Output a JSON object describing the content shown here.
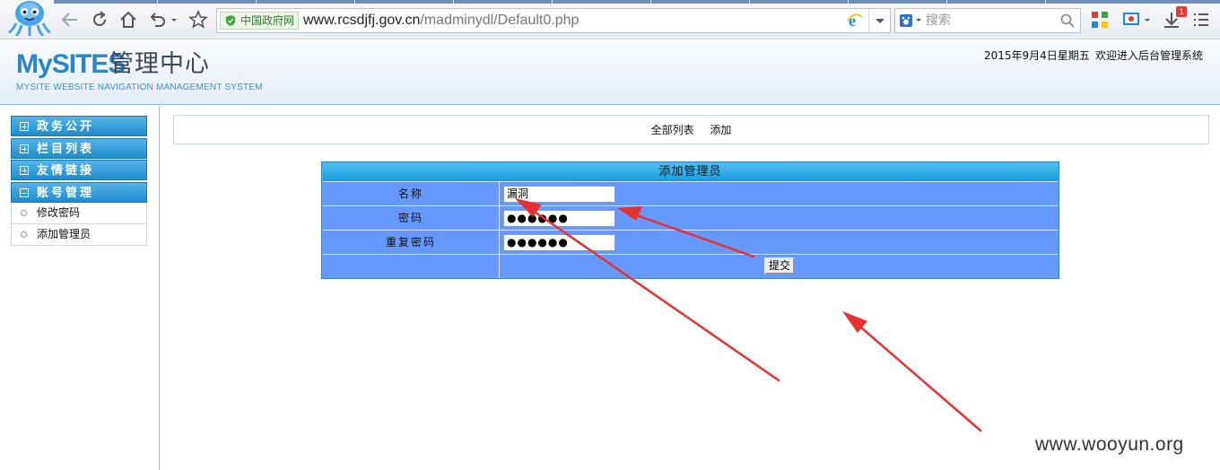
{
  "browser": {
    "url_host": "www.rcsdjfj.gov.cn",
    "url_path": "/madminydl/Default0.php",
    "gov_badge": "中国政府网",
    "search_placeholder": "搜索",
    "download_badge": "1"
  },
  "header": {
    "brand_part1": "My",
    "brand_part2": "SITES",
    "brand_cn": "管理中心",
    "brand_sub": "MYSITE WEBSITE NAVIGATION MANAGEMENT SYSTEM",
    "date": "2015年9月4日星期五",
    "welcome": "欢迎进入后台管理系统"
  },
  "sidebar": {
    "menus": [
      {
        "label": "政务公开",
        "expanded": false
      },
      {
        "label": "栏目列表",
        "expanded": false
      },
      {
        "label": "友情链接",
        "expanded": false
      },
      {
        "label": "账号管理",
        "expanded": true
      }
    ],
    "sub_items": [
      "修改密码",
      "添加管理员"
    ]
  },
  "toplinks": [
    "全部列表",
    "添加"
  ],
  "form": {
    "title": "添加管理员",
    "fields": [
      {
        "label": "名称",
        "value": "漏洞"
      },
      {
        "label": "密码",
        "value": "●●●●●●"
      },
      {
        "label": "重复密码",
        "value": "●●●●●●"
      }
    ],
    "submit_label": "提交"
  },
  "annotation_color": "#e8312f",
  "watermark": "www.wooyun.org"
}
